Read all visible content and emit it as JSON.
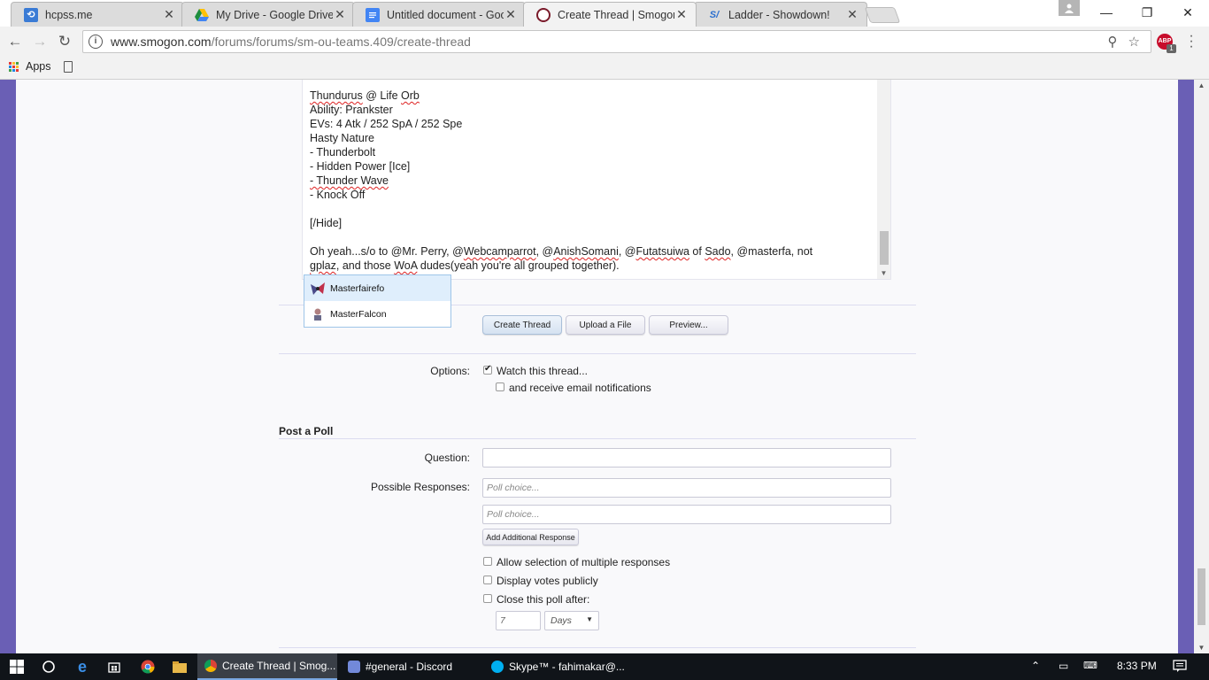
{
  "browser": {
    "tabs": [
      {
        "title": "hcpss.me",
        "icon": "hcpss-favicon",
        "active": false
      },
      {
        "title": "My Drive - Google Drive",
        "icon": "google-drive-icon",
        "active": false
      },
      {
        "title": "Untitled document - Goo",
        "icon": "google-docs-icon",
        "active": false
      },
      {
        "title": "Create Thread | Smogon",
        "icon": "smogon-icon",
        "active": true
      },
      {
        "title": "Ladder - Showdown!",
        "icon": "showdown-icon",
        "active": false
      }
    ],
    "url_host": "www.smogon.com",
    "url_path": "/forums/forums/sm-ou-teams.409/create-thread",
    "bookmarks": {
      "apps_label": "Apps"
    },
    "abp_label": "ABP",
    "abp_count": "1"
  },
  "editor": {
    "lines": [
      [
        {
          "t": "Thundurus",
          "s": true
        },
        {
          "t": " @ Life "
        },
        {
          "t": "Orb",
          "s": true
        }
      ],
      [
        {
          "t": "Ability: Prankster"
        }
      ],
      [
        {
          "t": "EVs: 4 Atk / 252 SpA / 252 Spe"
        }
      ],
      [
        {
          "t": "Hasty Nature"
        }
      ],
      [
        {
          "t": "- Thunderbolt"
        }
      ],
      [
        {
          "t": "- Hidden Power [Ice]"
        }
      ],
      [
        {
          "t": "- Thunder Wave",
          "s": true
        }
      ],
      [
        {
          "t": "- Knock Off"
        }
      ],
      [
        {
          "t": ""
        }
      ],
      [
        {
          "t": "[/Hide]"
        }
      ],
      [
        {
          "t": ""
        }
      ],
      [
        {
          "t": "Oh yeah...s/o to @Mr. Perry, @"
        },
        {
          "t": "Webcamparrot",
          "s": true
        },
        {
          "t": ", @"
        },
        {
          "t": "AnishSomani",
          "s": true
        },
        {
          "t": ", @"
        },
        {
          "t": "Futatsuiwa",
          "s": true
        },
        {
          "t": " of "
        },
        {
          "t": "Sado",
          "s": true
        },
        {
          "t": ", @masterfa, not"
        }
      ],
      [
        {
          "t": "gplaz",
          "s": true
        },
        {
          "t": ", and those "
        },
        {
          "t": "WoA",
          "s": true
        },
        {
          "t": " dudes(yeah you're all grouped together)."
        }
      ]
    ]
  },
  "mention_suggestions": [
    {
      "name": "Masterfairefo",
      "highlighted": true
    },
    {
      "name": "MasterFalcon",
      "highlighted": false
    }
  ],
  "actions": {
    "create_thread": "Create Thread",
    "upload_file": "Upload a File",
    "preview": "Preview..."
  },
  "options": {
    "label": "Options:",
    "watch_thread": {
      "label": "Watch this thread...",
      "checked": true
    },
    "email_notifications": {
      "label": "and receive email notifications",
      "checked": false
    }
  },
  "poll": {
    "title": "Post a Poll",
    "question_label": "Question:",
    "question_value": "",
    "responses_label": "Possible Responses:",
    "response_placeholders": [
      "Poll choice...",
      "Poll choice..."
    ],
    "add_response": "Add Additional Response",
    "allow_multiple": {
      "label": "Allow selection of multiple responses",
      "checked": false
    },
    "display_votes": {
      "label": "Display votes publicly",
      "checked": false
    },
    "close_after": {
      "label": "Close this poll after:",
      "checked": false
    },
    "close_value": "7",
    "close_unit": "Days"
  },
  "taskbar": {
    "tasks": [
      {
        "title": "Create Thread | Smog...",
        "icon": "chrome-icon",
        "active": true
      },
      {
        "title": "#general - Discord",
        "icon": "discord-icon",
        "active": false
      },
      {
        "title": "Skype™ - fahimakar@...",
        "icon": "skype-icon",
        "active": false
      }
    ],
    "clock": "8:33 PM"
  },
  "colors": {
    "page_side": "#6a5fb5",
    "content_bg": "#f9f9fb",
    "taskbar": "#101419"
  }
}
